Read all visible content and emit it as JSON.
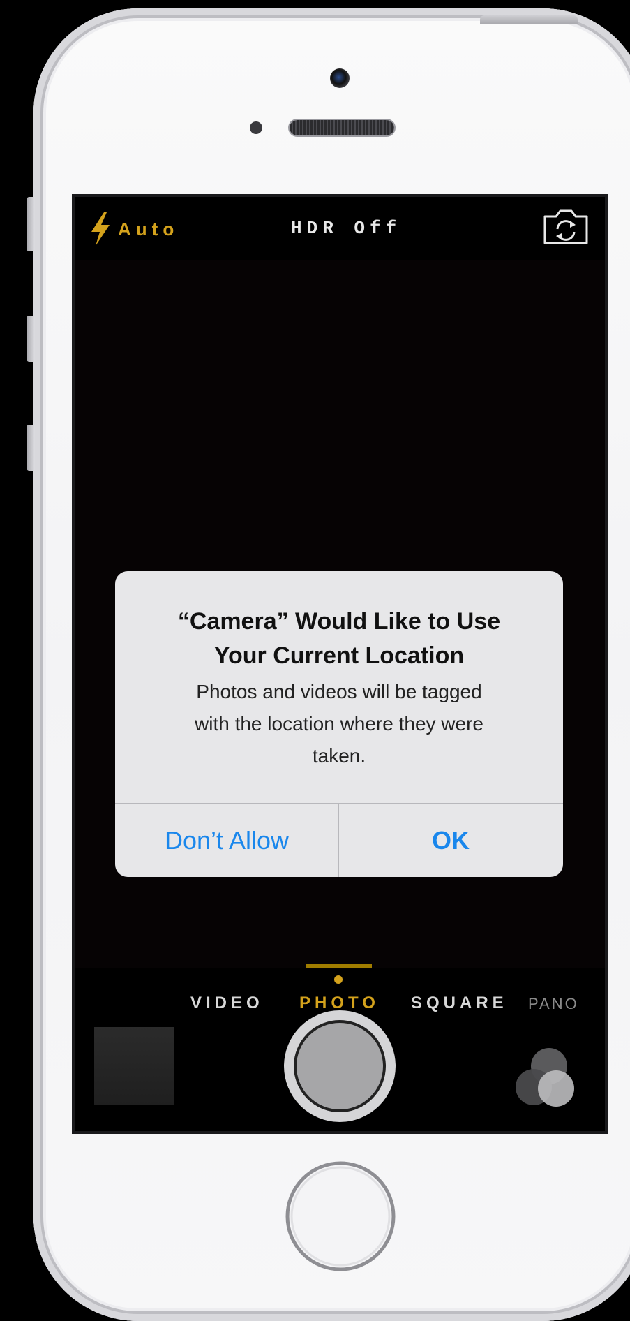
{
  "camera": {
    "flash_label": "Auto",
    "hdr_label": "HDR Off",
    "modes": [
      "VIDEO",
      "PHOTO",
      "SQUARE",
      "PANO"
    ],
    "active_mode": "PHOTO"
  },
  "alert": {
    "title_line1": "“Camera” Would Like to Use",
    "title_line2": "Your Current Location",
    "message_line1": "Photos and videos will be tagged",
    "message_line2": "with the location where they were",
    "message_line3": "taken.",
    "deny_label": "Don’t Allow",
    "ok_label": "OK"
  },
  "colors": {
    "accent_yellow": "#d4a21c",
    "ios_blue": "#1a87ec"
  },
  "icons": {
    "flash": "lightning-bolt-icon",
    "flip_camera": "camera-flip-icon",
    "filters": "filters-icon"
  }
}
